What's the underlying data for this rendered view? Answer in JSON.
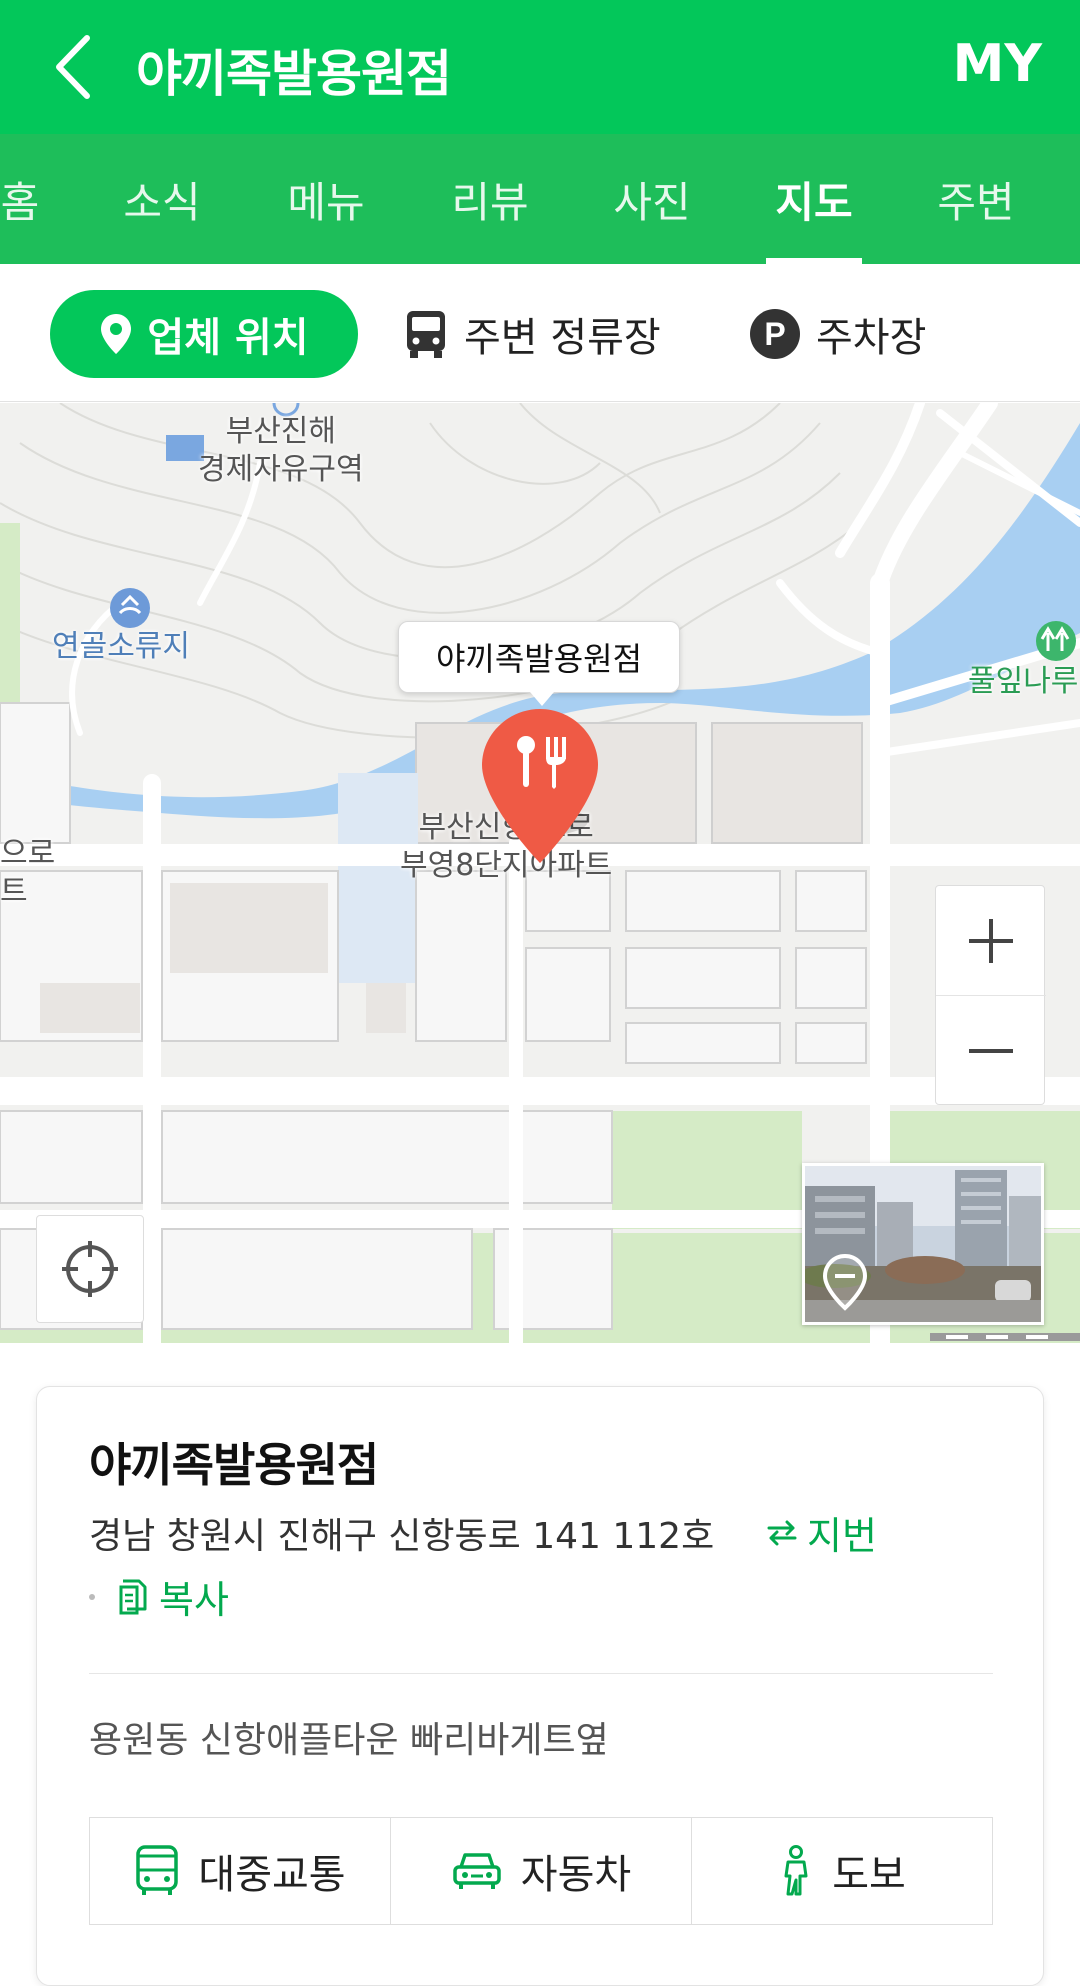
{
  "header": {
    "title": "야끼족발용원점",
    "my_label": "MY"
  },
  "tabs": [
    {
      "label": "홈"
    },
    {
      "label": "소식"
    },
    {
      "label": "메뉴"
    },
    {
      "label": "리뷰"
    },
    {
      "label": "사진"
    },
    {
      "label": "지도",
      "active": true
    },
    {
      "label": "주변"
    }
  ],
  "chips": {
    "location": "업체 위치",
    "bus_stops": "주변 정류장",
    "parking": "주차장",
    "parking_badge": "P"
  },
  "map": {
    "labels": {
      "station": "부산진해\n경제자유구역",
      "reservoir": "연골소류지",
      "park": "풀잎나루",
      "apartment": "부산신항 으로\n부영8단지아파트",
      "left_edge": "으로\n트"
    },
    "callout": "야끼족발용원점",
    "pin_icon": "restaurant-pin-icon",
    "accent_water": "#a8cff2",
    "accent_green": "#d3ebc4",
    "pin_color": "#ef5a45"
  },
  "card": {
    "title": "야끼족발용원점",
    "address": "경남 창원시 진해구 신항동로 141 112호",
    "jibun_label": "지번",
    "copy_label": "복사",
    "landmark": "용원동 신항애플타운 빠리바게트옆",
    "transport": [
      {
        "label": "대중교통",
        "icon": "bus-icon"
      },
      {
        "label": "자동차",
        "icon": "car-icon"
      },
      {
        "label": "도보",
        "icon": "walk-icon"
      }
    ]
  },
  "colors": {
    "brand": "#03c75a",
    "brand_dark": "#03a94e"
  }
}
